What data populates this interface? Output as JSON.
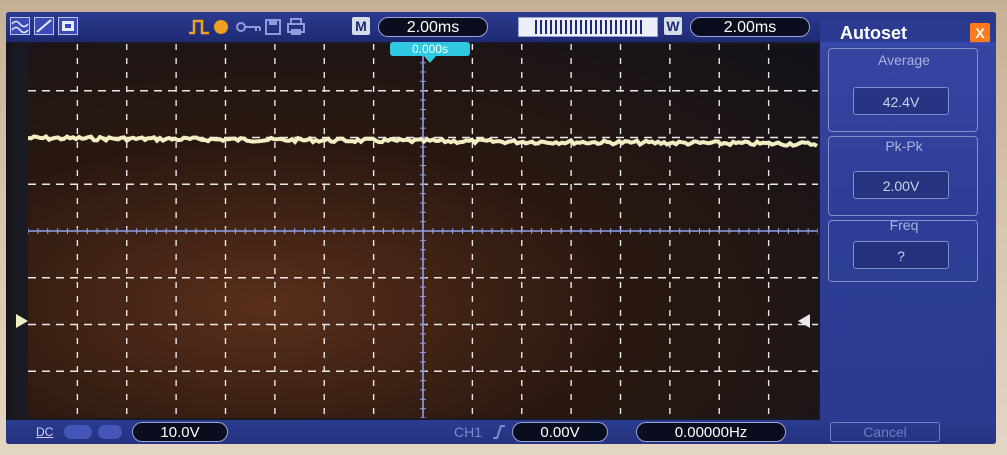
{
  "top_bar": {
    "mode_label": "M",
    "timebase": "2.00ms",
    "window_label": "W",
    "window_timebase": "2.00ms",
    "trigger_position": "0.000s"
  },
  "menu": {
    "title": "Autoset",
    "close_glyph": "X",
    "items": [
      {
        "title": "Average",
        "value": "42.4V"
      },
      {
        "title": "Pk-Pk",
        "value": "2.00V"
      },
      {
        "title": "Freq",
        "value": "?"
      }
    ],
    "cancel_label": "Cancel"
  },
  "bottom_bar": {
    "coupling": "DC",
    "volts_per_div": "10.0V",
    "channel_label": "CH1",
    "trigger_level": "0.00V",
    "frequency": "0.00000Hz"
  },
  "colors": {
    "accent": "#2b3b8f",
    "trace": "#f2eec4",
    "grid": "#e8e8e8",
    "close": "#ff7a1a",
    "trigger_marker": "#2ec8e0",
    "trigger_run": "#f0a020"
  }
}
